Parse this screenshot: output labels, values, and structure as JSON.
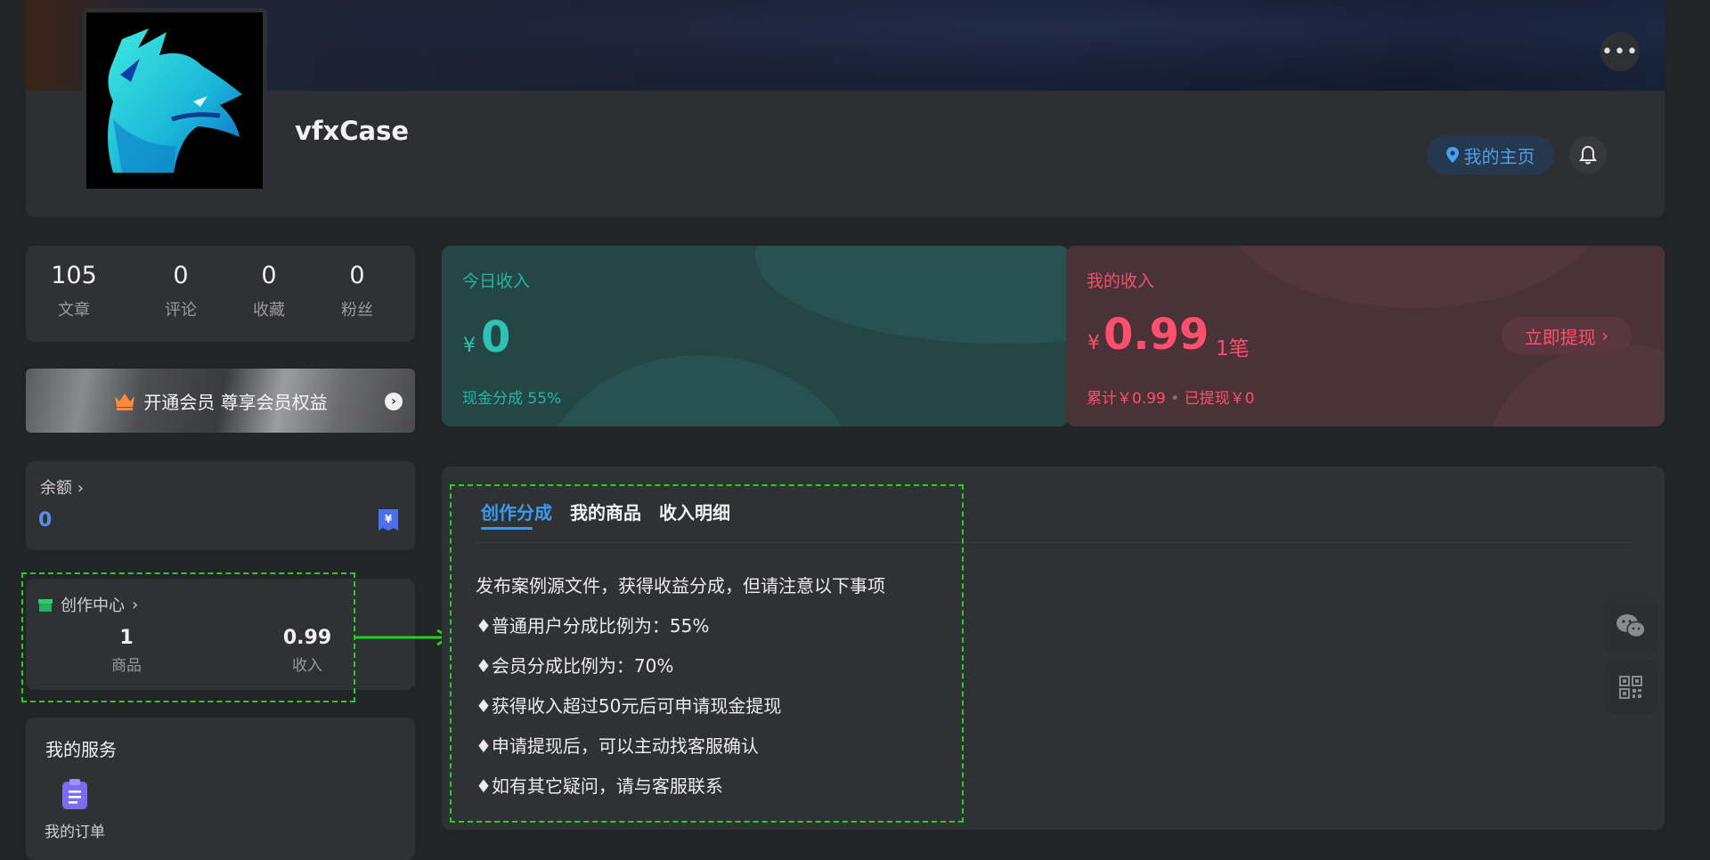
{
  "profile": {
    "username": "vfxCase",
    "home_button_label": "我的主页"
  },
  "stats": [
    {
      "value": "105",
      "label": "文章"
    },
    {
      "value": "0",
      "label": "评论"
    },
    {
      "value": "0",
      "label": "收藏"
    },
    {
      "value": "0",
      "label": "粉丝"
    }
  ],
  "vip": {
    "label": "开通会员 尊享会员权益"
  },
  "balance": {
    "label": "余额",
    "value": "0"
  },
  "creation_center": {
    "label": "创作中心",
    "items": [
      {
        "value": "1",
        "label": "商品"
      },
      {
        "value": "0.99",
        "label": "收入"
      }
    ]
  },
  "services": {
    "title": "我的服务",
    "items": [
      {
        "label": "我的订单"
      }
    ]
  },
  "today_income": {
    "label": "今日收入",
    "currency": "¥",
    "amount": "0",
    "share_text": "现金分成 55%"
  },
  "my_income": {
    "label": "我的收入",
    "currency": "¥",
    "amount": "0.99",
    "count": "1笔",
    "withdraw_label": "立即提现",
    "total_text": "累计￥0.99",
    "withdrawn_text": "已提现￥0"
  },
  "tabs": [
    {
      "label": "创作分成",
      "active": true
    },
    {
      "label": "我的商品",
      "active": false
    },
    {
      "label": "收入明细",
      "active": false
    }
  ],
  "notice_lines": [
    "发布案例源文件，获得收益分成，但请注意以下事项",
    "♦普通用户分成比例为：55%",
    "♦会员分成比例为：70%",
    "♦获得收入超过50元后可申请现金提现",
    "♦申请提现后，可以主动找客服确认",
    "♦如有其它疑问，请与客服联系"
  ],
  "colors": {
    "background": "#232426",
    "card": "#303134",
    "accent_blue": "#3a9bf0",
    "teal": "#2ec2b4",
    "pink": "#ff4f6c",
    "annotation_green": "#1fd41f"
  },
  "icons": [
    "more-icon",
    "map-pin-icon",
    "bell-icon",
    "crown-icon",
    "chevron-right-icon",
    "wallet-icon",
    "store-icon",
    "clipboard-icon",
    "wechat-icon",
    "qrcode-icon"
  ]
}
